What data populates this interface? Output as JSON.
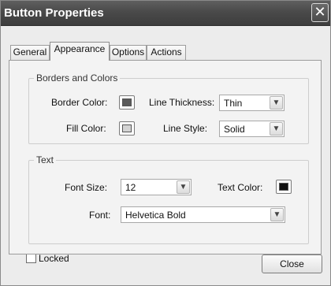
{
  "window": {
    "title": "Button Properties",
    "close_glyph": "✕"
  },
  "tabs": [
    {
      "label": "General",
      "active": false
    },
    {
      "label": "Appearance",
      "active": true
    },
    {
      "label": "Options",
      "active": false
    },
    {
      "label": "Actions",
      "active": false
    }
  ],
  "borders_colors": {
    "legend": "Borders and Colors",
    "border_color_label": "Border Color:",
    "border_color": "#5a5a5a",
    "line_thickness_label": "Line Thickness:",
    "line_thickness_value": "Thin",
    "fill_color_label": "Fill Color:",
    "fill_color": "#d4d4d4",
    "line_style_label": "Line Style:",
    "line_style_value": "Solid"
  },
  "text_group": {
    "legend": "Text",
    "font_size_label": "Font Size:",
    "font_size_value": "12",
    "text_color_label": "Text Color:",
    "text_color": "#111111",
    "font_label": "Font:",
    "font_value": "Helvetica Bold"
  },
  "footer": {
    "locked_label": "Locked",
    "locked_checked": false,
    "close_label": "Close"
  },
  "icons": {
    "dropdown_arrow": "chevron-down-icon",
    "dropdown_glyph": "▼"
  }
}
